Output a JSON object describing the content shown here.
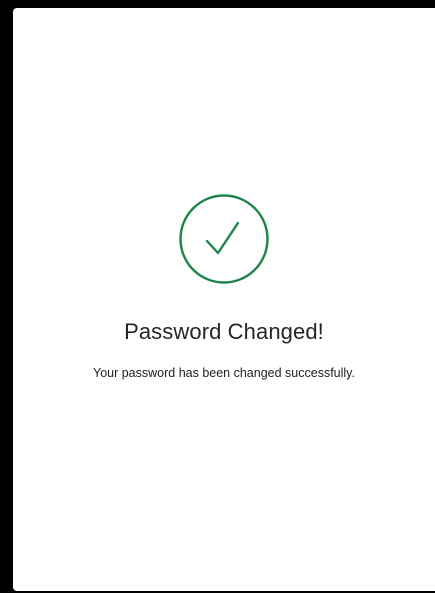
{
  "dialog": {
    "icon": "check-circle-icon",
    "accent_color": "#1e8449",
    "title": "Password Changed!",
    "message": "Your password has been changed successfully."
  }
}
